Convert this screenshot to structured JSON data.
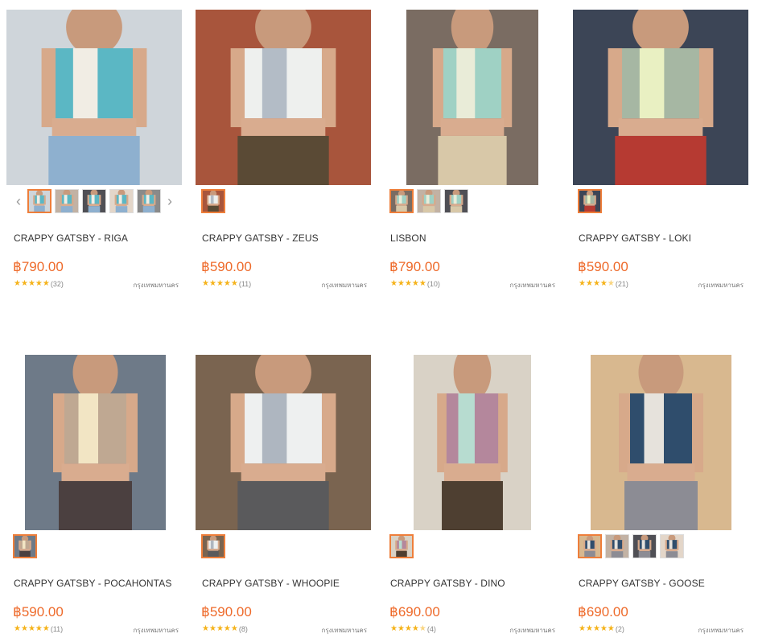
{
  "products": [
    {
      "title": "CRAPPY GATSBY - RIGA",
      "price": "฿790.00",
      "reviews": "(32)",
      "location": "กรุงเทพมหานคร",
      "rating_stars": 5,
      "thumb_count": 5,
      "has_arrows": true,
      "colors": {
        "bg": "#cfd5da",
        "top": "#5bb7c4",
        "accent": "#f1ede4",
        "pants": "#8eb0cf"
      }
    },
    {
      "title": "CRAPPY GATSBY - ZEUS",
      "price": "฿590.00",
      "reviews": "(11)",
      "location": "กรุงเทพมหานคร",
      "rating_stars": 5,
      "thumb_count": 1,
      "has_arrows": false,
      "colors": {
        "bg": "#a8553c",
        "top": "#eef0ee",
        "accent": "#b3bcc6",
        "pants": "#5a4a35"
      }
    },
    {
      "title": "LISBON",
      "price": "฿790.00",
      "reviews": "(10)",
      "location": "กรุงเทพมหานคร",
      "rating_stars": 5,
      "thumb_count": 3,
      "has_arrows": false,
      "colors": {
        "bg": "#7a6c62",
        "top": "#9fd1c4",
        "accent": "#e9ecd8",
        "pants": "#d8c8a8"
      }
    },
    {
      "title": "CRAPPY GATSBY - LOKI",
      "price": "฿590.00",
      "reviews": "(21)",
      "location": "กรุงเทพมหานคร",
      "rating_stars": 4.5,
      "thumb_count": 1,
      "has_arrows": false,
      "colors": {
        "bg": "#3c4556",
        "top": "#a6b7a3",
        "accent": "#e9f0c2",
        "pants": "#b63a32"
      }
    },
    {
      "title": "CRAPPY GATSBY - POCAHONTAS",
      "price": "฿590.00",
      "reviews": "(11)",
      "location": "กรุงเทพมหานคร",
      "rating_stars": 5,
      "thumb_count": 1,
      "has_arrows": false,
      "colors": {
        "bg": "#6e7a88",
        "top": "#bfa892",
        "accent": "#f2e5c4",
        "pants": "#4b4040"
      }
    },
    {
      "title": "CRAPPY GATSBY - WHOOPIE",
      "price": "฿590.00",
      "reviews": "(8)",
      "location": "กรุงเทพมหานคร",
      "rating_stars": 5,
      "thumb_count": 1,
      "has_arrows": false,
      "colors": {
        "bg": "#7a6450",
        "top": "#eef0f0",
        "accent": "#aeb6c0",
        "pants": "#5a5a5c"
      }
    },
    {
      "title": "CRAPPY GATSBY - DINO",
      "price": "฿690.00",
      "reviews": "(4)",
      "location": "กรุงเทพมหานคร",
      "rating_stars": 4.5,
      "thumb_count": 1,
      "has_arrows": false,
      "colors": {
        "bg": "#d9d2c6",
        "top": "#b4879c",
        "accent": "#b7dcd0",
        "pants": "#4e3f31"
      }
    },
    {
      "title": "CRAPPY GATSBY - GOOSE",
      "price": "฿690.00",
      "reviews": "(2)",
      "location": "กรุงเทพมหานคร",
      "rating_stars": 5,
      "thumb_count": 4,
      "has_arrows": false,
      "colors": {
        "bg": "#d8b88f",
        "top": "#2f4d6c",
        "accent": "#e6e2dc",
        "pants": "#8c8c94"
      }
    }
  ],
  "icons": {
    "star": "star-icon",
    "prev": "chevron-left-icon",
    "next": "chevron-right-icon"
  }
}
